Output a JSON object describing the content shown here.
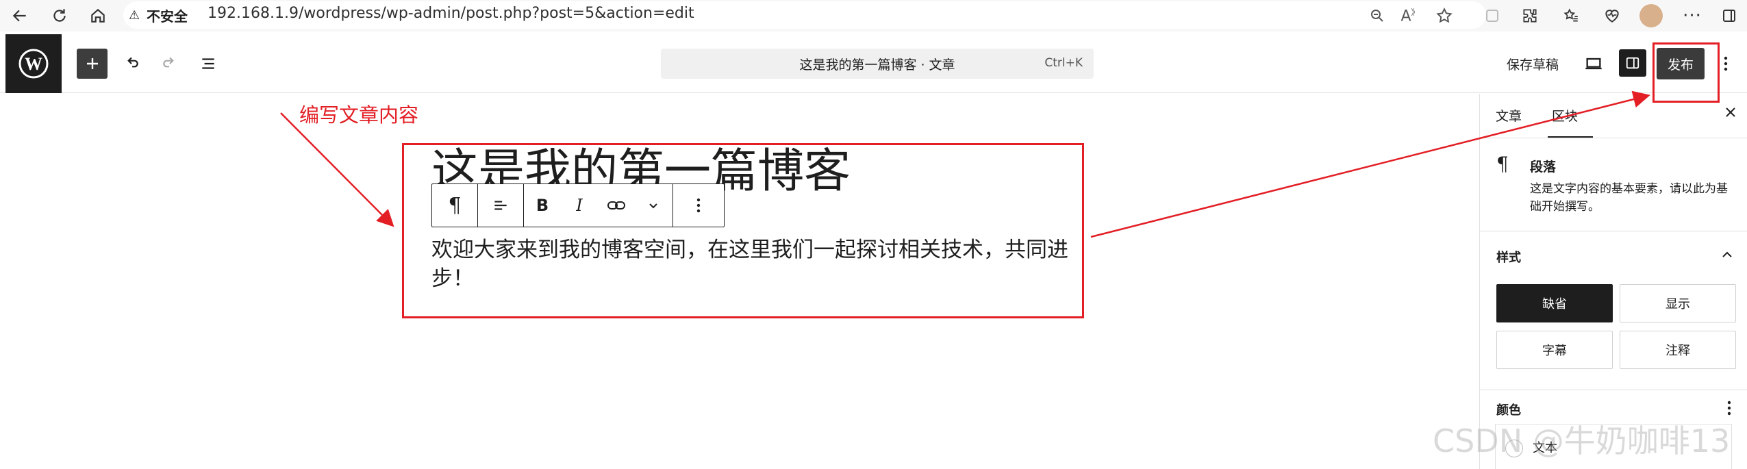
{
  "browser": {
    "security_label": "不安全",
    "url": "192.168.1.9/wordpress/wp-admin/post.php?post=5&action=edit"
  },
  "toolbar": {
    "document_title": "这是我的第一篇博客 · 文章",
    "shortcut": "Ctrl+K",
    "save_draft": "保存草稿",
    "publish": "发布"
  },
  "editor": {
    "post_title": "这是我的第一篇博客",
    "paragraph": "欢迎大家来到我的博客空间，在这里我们一起探讨相关技术，共同进步！"
  },
  "annotation": {
    "label": "编写文章内容",
    "color": "#e31e25"
  },
  "sidebar": {
    "tabs": [
      {
        "label": "文章"
      },
      {
        "label": "区块"
      }
    ],
    "block_name": "段落",
    "block_description": "这是文字内容的基本要素，请以此为基础开始撰写。",
    "styles_heading": "样式",
    "styles": [
      {
        "label": "缺省"
      },
      {
        "label": "显示"
      },
      {
        "label": "字幕"
      },
      {
        "label": "注释"
      }
    ],
    "color_heading": "颜色",
    "color_text": "文本"
  },
  "watermark": "CSDN @牛奶咖啡13"
}
